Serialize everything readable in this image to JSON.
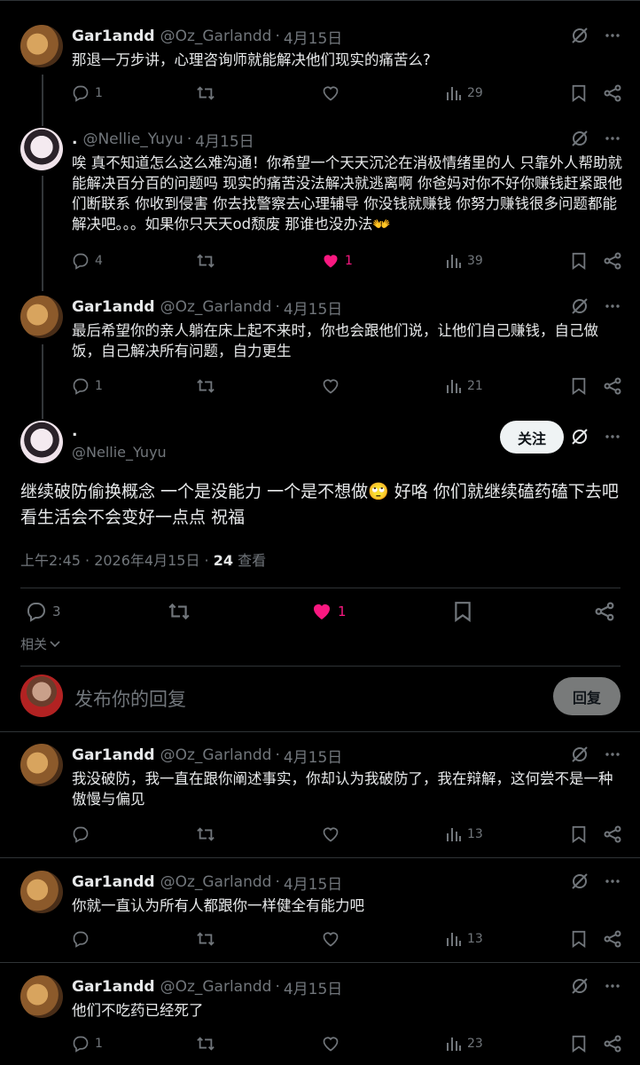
{
  "posts": [
    {
      "name": "Gar1andd",
      "handle": "@Oz_Garlandd",
      "date": "4月15日",
      "text": "那退一万步讲，心理咨询师就能解决他们现实的痛苦么?",
      "replies": "1",
      "retweets": "",
      "likes": "",
      "views": "29"
    },
    {
      "name": ".",
      "handle": "@Nellie_Yuyu",
      "date": "4月15日",
      "text": "唉 真不知道怎么这么难沟通！你希望一个天天沉沦在消极情绪里的人 只靠外人帮助就能解决百分百的问题吗 现实的痛苦没法解决就逃离啊 你爸妈对你不好你赚钱赶紧跟他们断联系 你收到侵害 你去找警察去心理辅导 你没钱就赚钱 你努力赚钱很多问题都能解决吧。。。如果你只天天od颓废 那谁也没办法👐",
      "replies": "4",
      "retweets": "",
      "likes": "1",
      "views": "39"
    },
    {
      "name": "Gar1andd",
      "handle": "@Oz_Garlandd",
      "date": "4月15日",
      "text": "最后希望你的亲人躺在床上起不来时，你也会跟他们说，让他们自己赚钱，自己做饭，自己解决所有问题，自力更生",
      "replies": "1",
      "retweets": "",
      "likes": "",
      "views": "21"
    }
  ],
  "main": {
    "name": ".",
    "handle": "@Nellie_Yuyu",
    "follow_label": "关注",
    "text": "继续破防偷换概念 一个是没能力 一个是不想做🙄 好咯 你们就继续磕药磕下去吧 看生活会不会变好一点点 祝福",
    "time": "上午2:45 · 2026年4月15日 · ",
    "views_count": "24",
    "views_label": " 查看",
    "replies": "3",
    "likes": "1",
    "related": "相关"
  },
  "composer": {
    "placeholder": "发布你的回复",
    "button": "回复"
  },
  "replies": [
    {
      "name": "Gar1andd",
      "handle": "@Oz_Garlandd",
      "date": "4月15日",
      "text": "我没破防，我一直在跟你阐述事实，你却认为我破防了，我在辩解，这何尝不是一种傲慢与偏见",
      "replies": "",
      "views": "13"
    },
    {
      "name": "Gar1andd",
      "handle": "@Oz_Garlandd",
      "date": "4月15日",
      "text": "你就一直认为所有人都跟你一样健全有能力吧",
      "replies": "",
      "views": "13"
    },
    {
      "name": "Gar1andd",
      "handle": "@Oz_Garlandd",
      "date": "4月15日",
      "text": "他们不吃药已经死了",
      "replies": "1",
      "views": "23"
    }
  ],
  "colors": {
    "like": "#f91880",
    "muted": "#71767b",
    "background": "#000000"
  }
}
